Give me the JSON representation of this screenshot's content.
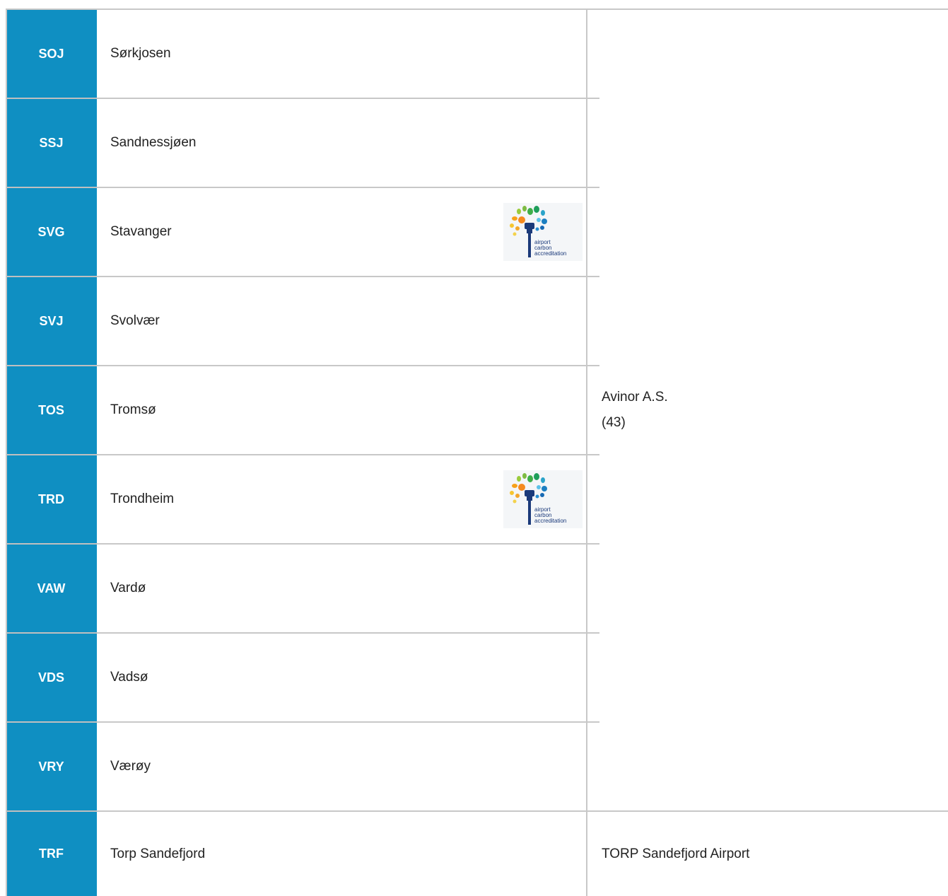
{
  "rows": [
    {
      "code": "SOJ",
      "name": "Sørkjosen",
      "aca": false
    },
    {
      "code": "SSJ",
      "name": "Sandnessjøen",
      "aca": false
    },
    {
      "code": "SVG",
      "name": "Stavanger",
      "aca": true
    },
    {
      "code": "SVJ",
      "name": "Svolvær",
      "aca": false
    },
    {
      "code": "TOS",
      "name": "Tromsø",
      "aca": false
    },
    {
      "code": "TRD",
      "name": "Trondheim",
      "aca": true
    },
    {
      "code": "VAW",
      "name": "Vardø",
      "aca": false
    },
    {
      "code": "VDS",
      "name": "Vadsø",
      "aca": false
    },
    {
      "code": "VRY",
      "name": "Værøy",
      "aca": false
    },
    {
      "code": "TRF",
      "name": "Torp Sandefjord",
      "aca": false
    }
  ],
  "operators": [
    {
      "name": "Avinor A.S.",
      "count": "(43)"
    },
    {
      "name": "TORP Sandefjord Airport",
      "count": ""
    }
  ],
  "aca_logo": {
    "line1": "airport",
    "line2": "carbon",
    "line3": "accreditation",
    "text_color": "#1b3a7a"
  },
  "colors": {
    "code_bg": "#0f8fc2",
    "border": "#c8c8c8"
  }
}
